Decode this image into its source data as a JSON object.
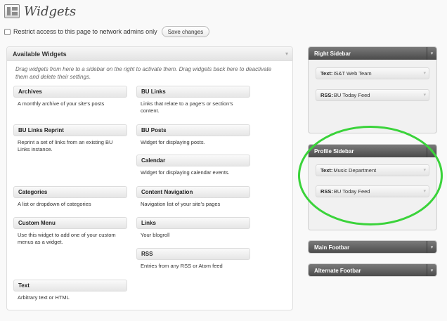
{
  "page": {
    "title": "Widgets"
  },
  "restrict": {
    "label": "Restrict access to this page to network admins only",
    "save_label": "Save changes"
  },
  "available": {
    "title": "Available Widgets",
    "description": "Drag widgets from here to a sidebar on the right to activate them. Drag widgets back here to deactivate them and delete their settings.",
    "widgets": [
      {
        "title": "Archives",
        "desc": "A monthly archive of your site’s posts"
      },
      {
        "title": "BU Links",
        "desc": "Links that relate to a page’s or section’s content."
      },
      {
        "title": "BU Links Reprint",
        "desc": "Reprint a set of links from an existing BU Links instance."
      },
      {
        "title": "BU Posts",
        "desc": "Widget for displaying posts."
      },
      {
        "title": "Calendar",
        "desc": "Widget for displaying calendar events."
      },
      {
        "title": "Categories",
        "desc": "A list or dropdown of categories"
      },
      {
        "title": "Content Navigation",
        "desc": "Navigation list of your site’s pages"
      },
      {
        "title": "Custom Menu",
        "desc": "Use this widget to add one of your custom menus as a widget."
      },
      {
        "title": "Links",
        "desc": "Your blogroll"
      },
      {
        "title": "RSS",
        "desc": "Entries from any RSS or Atom feed"
      },
      {
        "title": "Text",
        "desc": "Arbitrary text or HTML"
      }
    ]
  },
  "sidebars": {
    "right": {
      "title": "Right Sidebar",
      "widgets": [
        {
          "type": "Text:",
          "name": "IS&T Web Team"
        },
        {
          "type": "RSS:",
          "name": "BU Today Feed"
        }
      ]
    },
    "profile": {
      "title": "Profile Sidebar",
      "widgets": [
        {
          "type": "Text:",
          "name": "Music Department"
        },
        {
          "type": "RSS:",
          "name": "BU Today Feed"
        }
      ]
    },
    "main_footbar": {
      "title": "Main Footbar"
    },
    "alternate_footbar": {
      "title": "Alternate Footbar"
    }
  },
  "icons": {
    "arrow": "▾"
  },
  "colors": {
    "highlight_ring": "#3ad33a"
  }
}
